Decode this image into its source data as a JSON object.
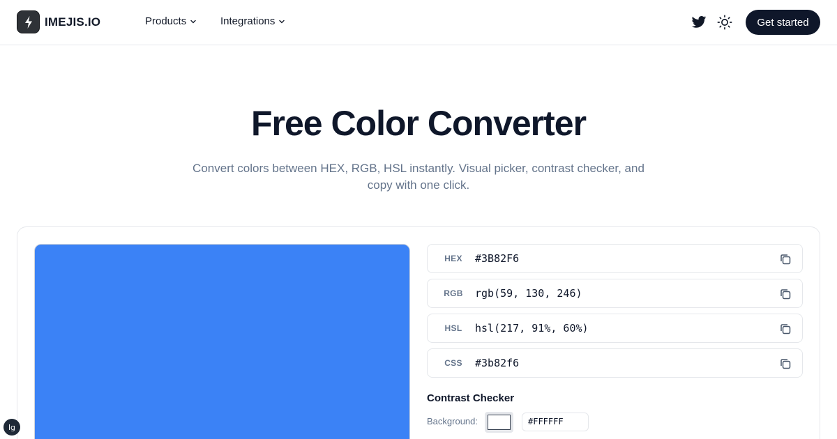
{
  "header": {
    "brand": "IMEJIS.IO",
    "nav": [
      {
        "label": "Products"
      },
      {
        "label": "Integrations"
      }
    ],
    "cta_label": "Get started",
    "icons": [
      "logo-bolt-icon",
      "twitter-icon",
      "sun-icon",
      "chevron-down-icon"
    ]
  },
  "hero": {
    "title": "Free Color Converter",
    "subtitle": "Convert colors between HEX, RGB, HSL instantly. Visual picker, contrast checker, and copy with one click."
  },
  "converter": {
    "current_color": "#3B82F6",
    "formats": [
      {
        "label": "HEX",
        "value": "#3B82F6"
      },
      {
        "label": "RGB",
        "value": "rgb(59, 130, 246)"
      },
      {
        "label": "HSL",
        "value": "hsl(217, 91%, 60%)"
      },
      {
        "label": "CSS",
        "value": "#3b82f6"
      }
    ],
    "contrast": {
      "title": "Contrast Checker",
      "background_label": "Background:",
      "background_value": "#FFFFFF"
    }
  },
  "badge": "lg",
  "colors": {
    "accent": "#3b82f6",
    "dark": "#0f172a",
    "muted": "#64748b",
    "border": "#e5e7eb"
  }
}
